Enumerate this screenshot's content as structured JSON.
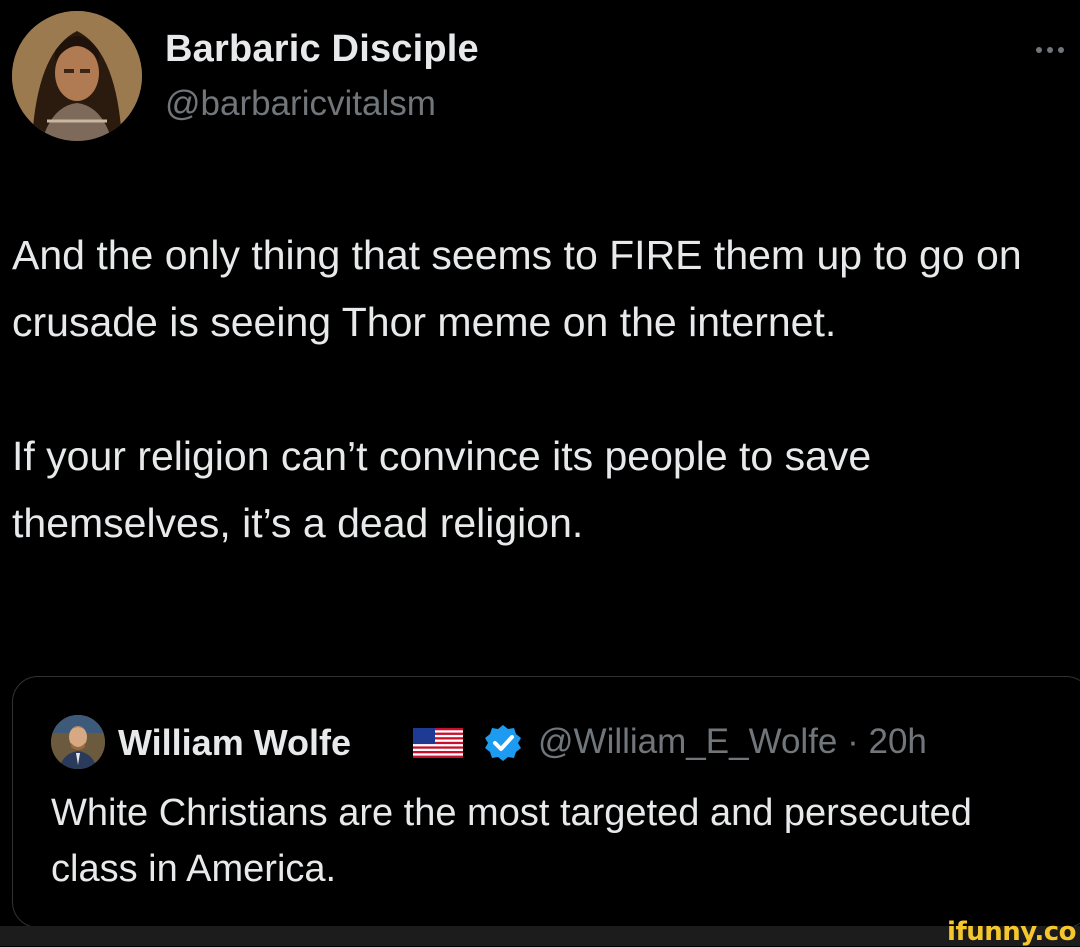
{
  "author": {
    "name": "Barbaric Disciple",
    "handle": "@barbaricvitalsm",
    "avatar_icon": "barbarian-portrait"
  },
  "more_icon": "more-options-icon",
  "tweet": {
    "paragraphs": [
      "And the only thing that seems to FIRE them up to go on crusade is seeing Thor meme on the internet.",
      "If your religion can’t convince its people to save themselves, it’s a dead religion."
    ]
  },
  "quoted": {
    "name": "William Wolfe",
    "flag_icon": "us-flag-icon",
    "verified_icon": "verified-badge-icon",
    "handle_time": "@William_E_Wolfe · 20h",
    "text": "White Christians are the most targeted and persecuted class in America."
  },
  "watermark": "ifunny.co",
  "colors": {
    "background": "#000000",
    "text": "#e7e9ea",
    "secondary": "#71767b",
    "verified": "#1d9bf0",
    "watermark": "#f6c72d"
  }
}
